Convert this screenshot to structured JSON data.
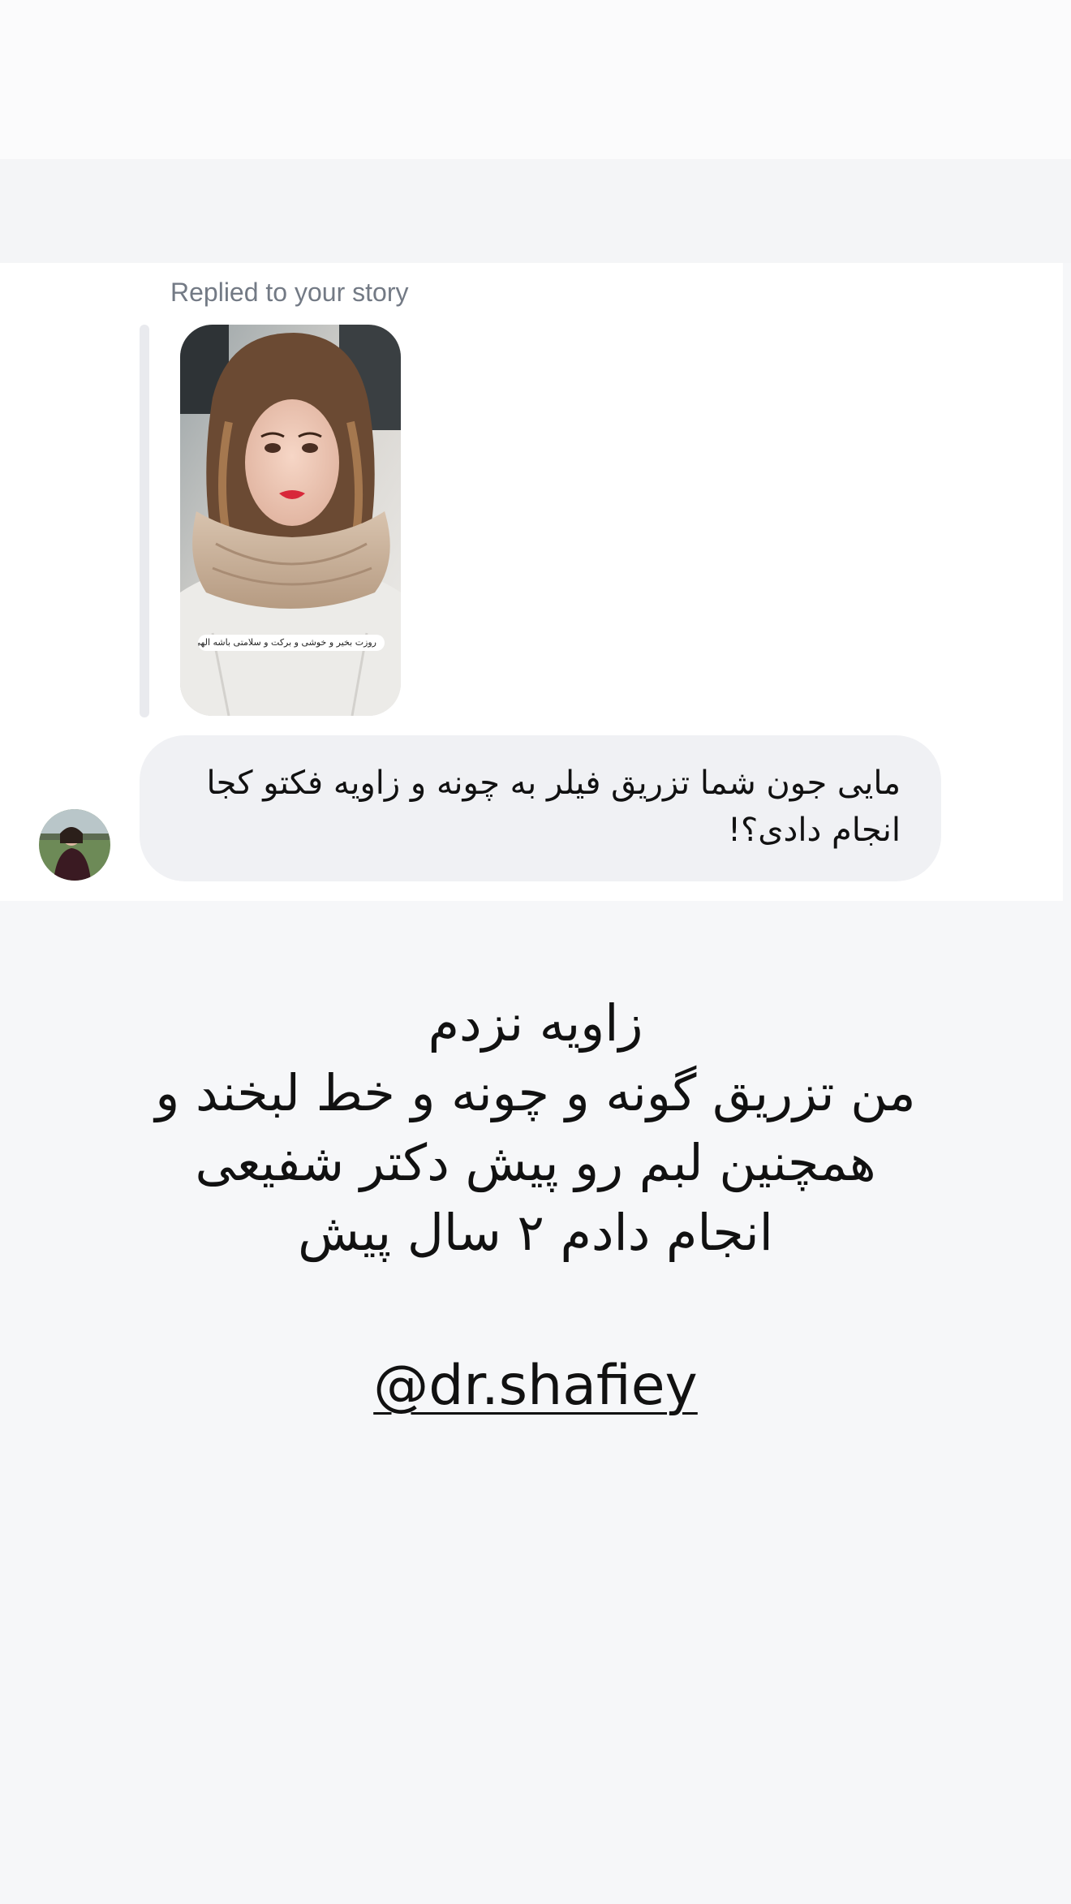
{
  "dm": {
    "replied_label": "Replied to your story",
    "story_caption": "روزت بخیر و خوشی و برکت و سلامتی باشه الهی ❤️",
    "message": "مایی جون شما تزریق فیلر به چونه و زاویه فکتو کجا انجام دادی؟!"
  },
  "answer": {
    "lines": [
      "زاویه نزدم",
      "من تزریق گونه و چونه و خط لبخند و",
      "همچنین لبم رو پیش دکتر شفیعی",
      "انجام دادم ۲ سال پیش"
    ]
  },
  "mention": "@dr.shafiey",
  "colors": {
    "background": "#f6f7f9",
    "card": "#ffffff",
    "bubble": "#f0f1f4",
    "label_gray": "#737a85"
  }
}
